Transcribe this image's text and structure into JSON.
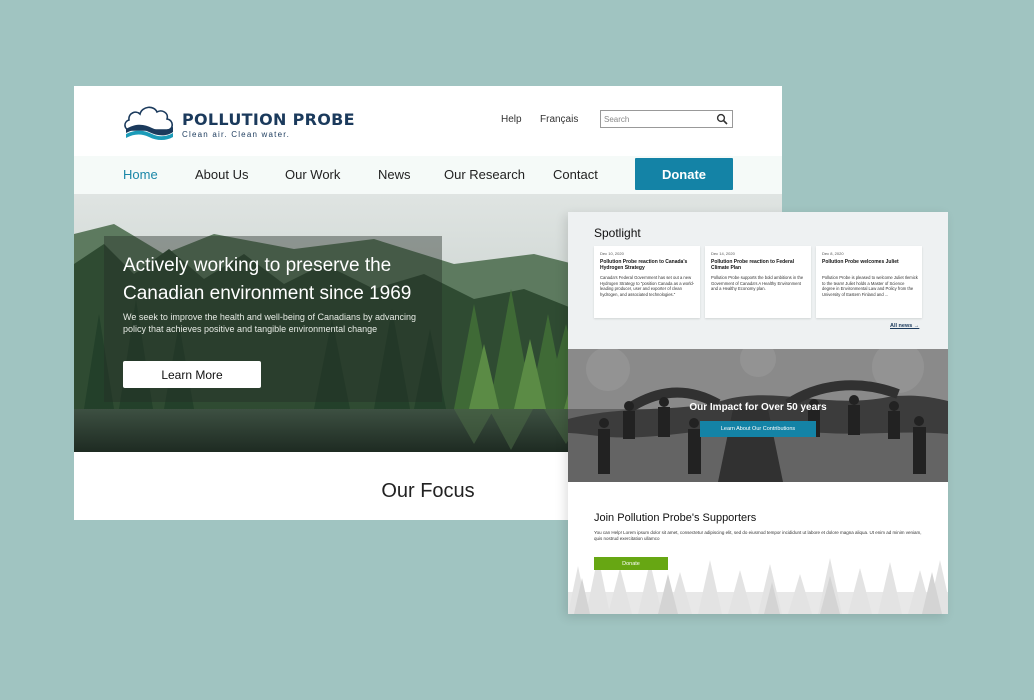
{
  "logo": {
    "name": "POLLUTION PROBE",
    "tagline": "Clean air. Clean water."
  },
  "top_links": {
    "help": "Help",
    "french": "Français"
  },
  "search": {
    "placeholder": "Search"
  },
  "nav": {
    "items": [
      {
        "label": "Home",
        "active": true
      },
      {
        "label": "About Us"
      },
      {
        "label": "Our Work"
      },
      {
        "label": "News"
      },
      {
        "label": "Our Research"
      },
      {
        "label": "Contact"
      }
    ],
    "donate_label": "Donate"
  },
  "hero": {
    "title": "Actively working to preserve the Canadian environment since 1969",
    "subtitle": "We seek to improve the health and well-being of Canadians by advancing policy that achieves positive and tangible environmental change",
    "button_label": "Learn More"
  },
  "focus": {
    "title": "Our Focus"
  },
  "spotlight": {
    "title": "Spotlight",
    "cards": [
      {
        "date": "Dec 10, 2020",
        "headline": "Pollution Probe reaction to Canada's Hydrogen Strategy",
        "body": "Canada's Federal Government has set out a new Hydrogen Strategy to \"position Canada as a world-leading producer, user and exporter of clean hydrogen, and associated technologies.\""
      },
      {
        "date": "Dec 14, 2020",
        "headline": "Pollution Probe reaction to Federal Climate Plan",
        "body": "Pollution Probe supports the bold ambitions in the Government of Canada's A Healthy Environment and a Healthy Economy plan."
      },
      {
        "date": "Dec 8, 2020",
        "headline": "Pollution Probe welcomes Juliet",
        "body": "Pollution Probe is pleased to welcome Juliet Ilemick to the team! Juliet holds a Master of Science degree in Environmental Law and Policy from the University of Eastern Finland and ..."
      }
    ],
    "all_news": "All news →"
  },
  "impact": {
    "title": "Our Impact for Over 50 years",
    "button_label": "Learn About Our Contributions"
  },
  "join": {
    "title": "Join Pollution Probe's Supporters",
    "text": "You can Help! Lorem ipsum dolor sit amet, consectetur adipiscing elit, sed do eiusmod tempor incididunt ut labore et dolore magna aliqua. Ut enim ad minim veniam, quis nostrud exercitation ullamco",
    "button_label": "Donate"
  },
  "colors": {
    "background": "#a0c4c1",
    "brand_navy": "#1b3a5c",
    "accent_blue": "#1483a6",
    "nav_active": "#1b87a8",
    "donate_green": "#67a713"
  },
  "icons": {
    "search": "magnifier-icon",
    "logo": "cloud-wave-logo"
  }
}
